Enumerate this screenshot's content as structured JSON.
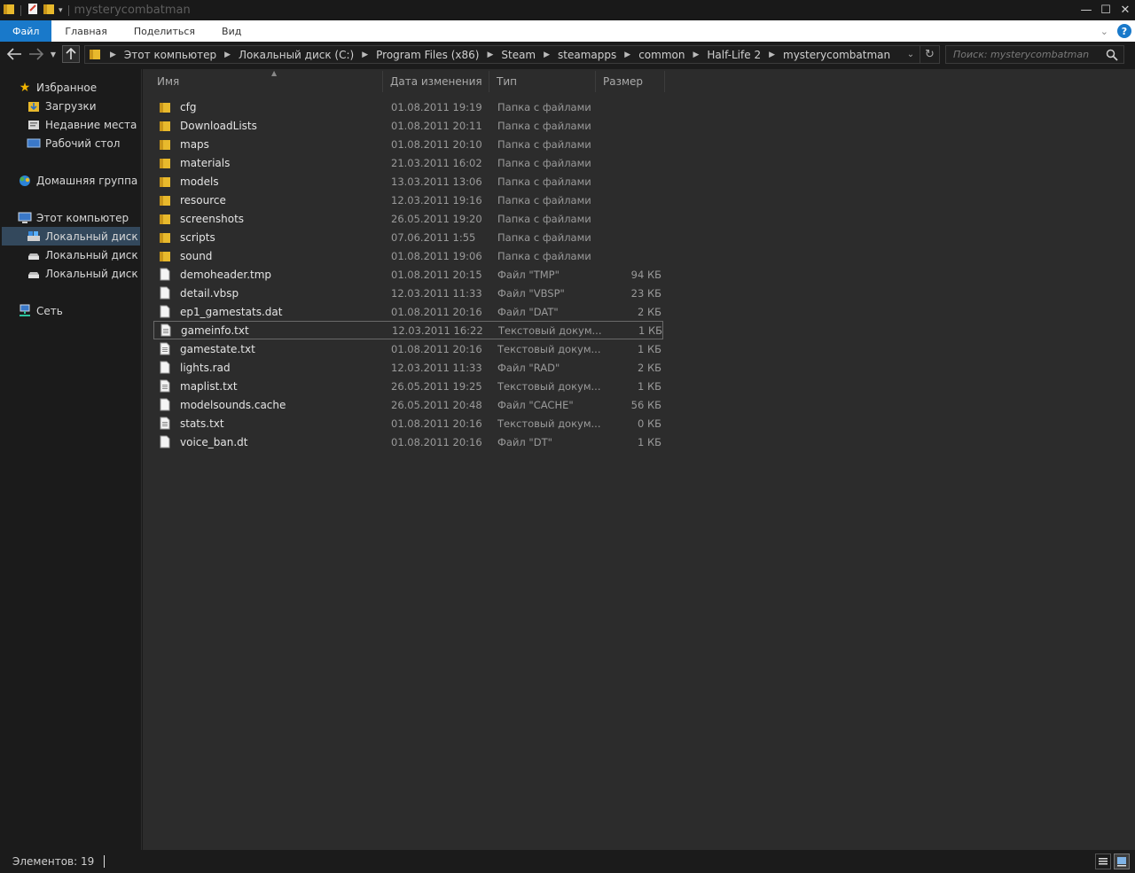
{
  "window": {
    "title": "mysterycombatman"
  },
  "ribbon": {
    "tabs": [
      "Файл",
      "Главная",
      "Поделиться",
      "Вид"
    ]
  },
  "address": {
    "crumbs": [
      "Этот компьютер",
      "Локальный диск (C:)",
      "Program Files (x86)",
      "Steam",
      "steamapps",
      "common",
      "Half-Life 2",
      "mysterycombatman"
    ]
  },
  "search": {
    "placeholder": "Поиск: mysterycombatman"
  },
  "nav": {
    "favorites": "Избранное",
    "downloads": "Загрузки",
    "recent": "Недавние места",
    "desktop": "Рабочий стол",
    "homegroup": "Домашняя группа",
    "computer": "Этот компьютер",
    "disk_c": "Локальный диск (C",
    "disk_d": "Локальный диск (D",
    "disk_e": "Локальный диск (E:",
    "network": "Сеть"
  },
  "columns": {
    "name": "Имя",
    "date": "Дата изменения",
    "type": "Тип",
    "size": "Размер"
  },
  "files": [
    {
      "name": "cfg",
      "date": "01.08.2011 19:19",
      "type": "Папка с файлами",
      "size": "",
      "kind": "folder"
    },
    {
      "name": "DownloadLists",
      "date": "01.08.2011 20:11",
      "type": "Папка с файлами",
      "size": "",
      "kind": "folder"
    },
    {
      "name": "maps",
      "date": "01.08.2011 20:10",
      "type": "Папка с файлами",
      "size": "",
      "kind": "folder"
    },
    {
      "name": "materials",
      "date": "21.03.2011 16:02",
      "type": "Папка с файлами",
      "size": "",
      "kind": "folder"
    },
    {
      "name": "models",
      "date": "13.03.2011 13:06",
      "type": "Папка с файлами",
      "size": "",
      "kind": "folder"
    },
    {
      "name": "resource",
      "date": "12.03.2011 19:16",
      "type": "Папка с файлами",
      "size": "",
      "kind": "folder"
    },
    {
      "name": "screenshots",
      "date": "26.05.2011 19:20",
      "type": "Папка с файлами",
      "size": "",
      "kind": "folder"
    },
    {
      "name": "scripts",
      "date": "07.06.2011 1:55",
      "type": "Папка с файлами",
      "size": "",
      "kind": "folder"
    },
    {
      "name": "sound",
      "date": "01.08.2011 19:06",
      "type": "Папка с файлами",
      "size": "",
      "kind": "folder"
    },
    {
      "name": "demoheader.tmp",
      "date": "01.08.2011 20:15",
      "type": "Файл \"TMP\"",
      "size": "94 КБ",
      "kind": "file"
    },
    {
      "name": "detail.vbsp",
      "date": "12.03.2011 11:33",
      "type": "Файл \"VBSP\"",
      "size": "23 КБ",
      "kind": "file"
    },
    {
      "name": "ep1_gamestats.dat",
      "date": "01.08.2011 20:16",
      "type": "Файл \"DAT\"",
      "size": "2 КБ",
      "kind": "file"
    },
    {
      "name": "gameinfo.txt",
      "date": "12.03.2011 16:22",
      "type": "Текстовый докум...",
      "size": "1 КБ",
      "kind": "text",
      "focused": true
    },
    {
      "name": "gamestate.txt",
      "date": "01.08.2011 20:16",
      "type": "Текстовый докум...",
      "size": "1 КБ",
      "kind": "text"
    },
    {
      "name": "lights.rad",
      "date": "12.03.2011 11:33",
      "type": "Файл \"RAD\"",
      "size": "2 КБ",
      "kind": "file"
    },
    {
      "name": "maplist.txt",
      "date": "26.05.2011 19:25",
      "type": "Текстовый докум...",
      "size": "1 КБ",
      "kind": "text"
    },
    {
      "name": "modelsounds.cache",
      "date": "26.05.2011 20:48",
      "type": "Файл \"CACHE\"",
      "size": "56 КБ",
      "kind": "file"
    },
    {
      "name": "stats.txt",
      "date": "01.08.2011 20:16",
      "type": "Текстовый докум...",
      "size": "0 КБ",
      "kind": "text"
    },
    {
      "name": "voice_ban.dt",
      "date": "01.08.2011 20:16",
      "type": "Файл \"DT\"",
      "size": "1 КБ",
      "kind": "file"
    }
  ],
  "status": {
    "items": "Элементов: 19"
  },
  "colors": {
    "accent": "#1979ca",
    "folder": "#e8b92c",
    "selection": "#33485c"
  }
}
